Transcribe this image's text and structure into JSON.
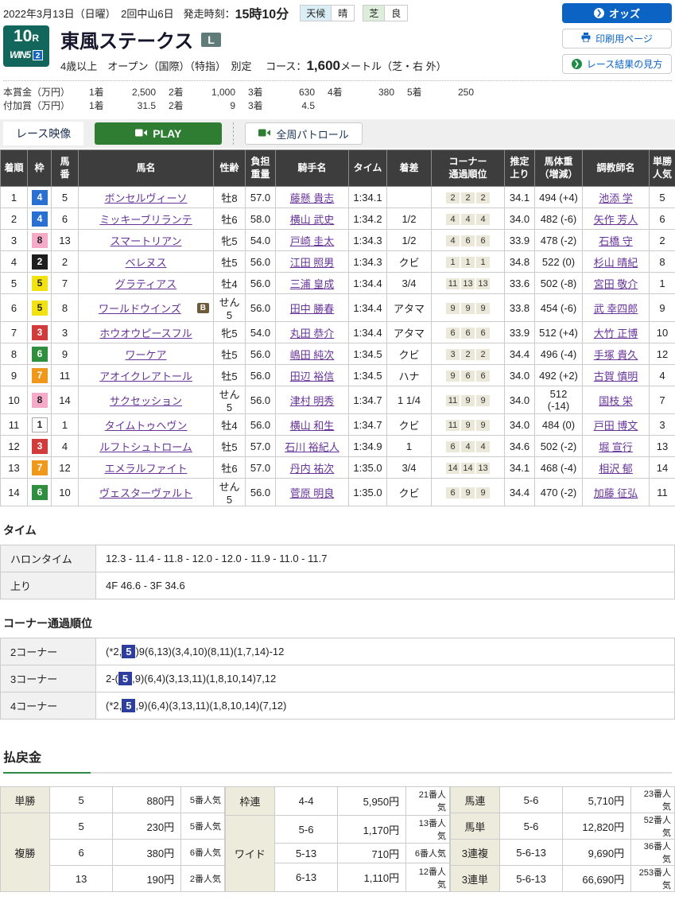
{
  "header": {
    "date_meet": "2022年3月13日（日曜）　2回中山6日",
    "start_label": "発走時刻：",
    "start_time": "15時10分",
    "weather_label": "天候",
    "weather_value": "晴",
    "turf_label": "芝",
    "turf_value": "良",
    "odds_button": "オッズ",
    "print_button": "印刷用ページ",
    "guide_button": "レース結果の見方"
  },
  "icons": {
    "odds_arrow": "❯",
    "guide_arrow": "❯",
    "printer": "printer-glyph",
    "camera": "camera-glyph"
  },
  "race": {
    "number": "10",
    "number_suffix": "R",
    "win5": "WIN5",
    "win5_num": "2",
    "name": "東風ステークス",
    "grade": "L",
    "conditions": "4歳以上　オープン（国際）（特指）　別定",
    "course_label": "コース：",
    "course_value": "1,600",
    "course_unit": "メートル（芝・右 外）"
  },
  "prize": {
    "main_label": "本賞金（万円）",
    "main": [
      {
        "r": "1着",
        "a": "2,500"
      },
      {
        "r": "2着",
        "a": "1,000"
      },
      {
        "r": "3着",
        "a": "630"
      },
      {
        "r": "4着",
        "a": "380"
      },
      {
        "r": "5着",
        "a": "250"
      }
    ],
    "added_label": "付加賞（万円）",
    "added": [
      {
        "r": "1着",
        "a": "31.5"
      },
      {
        "r": "2着",
        "a": "9"
      },
      {
        "r": "3着",
        "a": "4.5"
      }
    ]
  },
  "video": {
    "tab": "レース映像",
    "play": "PLAY",
    "patrol": "全周パトロール"
  },
  "results": {
    "headers": {
      "pos": "着順",
      "waku": "枠",
      "num": "馬\n番",
      "name": "馬名",
      "sexage": "性齢",
      "weight": "負担\n重量",
      "jockey": "騎手名",
      "time": "タイム",
      "margin": "着差",
      "corners": "コーナー\n通過順位",
      "last3f": "推定\n上り",
      "hweight": "馬体重\n（増減）",
      "trainer": "調教師名",
      "pop": "単勝\n人気"
    },
    "rows": [
      {
        "pos": "1",
        "waku": "4",
        "num": "5",
        "name": "ボンセルヴィーソ",
        "badge": "",
        "sexage": "牡8",
        "weight": "57.0",
        "jockey": "藤懸 貴志",
        "time": "1:34.1",
        "margin": "",
        "corners": [
          "2",
          "2",
          "2"
        ],
        "last3f": "34.1",
        "hweight": "494 (+4)",
        "trainer": "池添 学",
        "pop": "5"
      },
      {
        "pos": "2",
        "waku": "4",
        "num": "6",
        "name": "ミッキーブリランテ",
        "badge": "",
        "sexage": "牡6",
        "weight": "58.0",
        "jockey": "横山 武史",
        "time": "1:34.2",
        "margin": "1/2",
        "corners": [
          "4",
          "4",
          "4"
        ],
        "last3f": "34.0",
        "hweight": "482 (-6)",
        "trainer": "矢作 芳人",
        "pop": "6"
      },
      {
        "pos": "3",
        "waku": "8",
        "num": "13",
        "name": "スマートリアン",
        "badge": "",
        "sexage": "牝5",
        "weight": "54.0",
        "jockey": "戸崎 圭太",
        "time": "1:34.3",
        "margin": "1/2",
        "corners": [
          "4",
          "6",
          "6"
        ],
        "last3f": "33.9",
        "hweight": "478 (-2)",
        "trainer": "石橋 守",
        "pop": "2"
      },
      {
        "pos": "4",
        "waku": "2",
        "num": "2",
        "name": "ベレヌス",
        "badge": "",
        "sexage": "牡5",
        "weight": "56.0",
        "jockey": "江田 照男",
        "time": "1:34.3",
        "margin": "クビ",
        "corners": [
          "1",
          "1",
          "1"
        ],
        "last3f": "34.8",
        "hweight": "522 (0)",
        "trainer": "杉山 晴紀",
        "pop": "8"
      },
      {
        "pos": "5",
        "waku": "5",
        "num": "7",
        "name": "グラティアス",
        "badge": "",
        "sexage": "牡4",
        "weight": "56.0",
        "jockey": "三浦 皇成",
        "time": "1:34.4",
        "margin": "3/4",
        "corners": [
          "11",
          "13",
          "13"
        ],
        "last3f": "33.6",
        "hweight": "502 (-8)",
        "trainer": "宮田 敬介",
        "pop": "1"
      },
      {
        "pos": "6",
        "waku": "5",
        "num": "8",
        "name": "ワールドウインズ",
        "badge": "B",
        "sexage": "せん5",
        "weight": "56.0",
        "jockey": "田中 勝春",
        "time": "1:34.4",
        "margin": "アタマ",
        "corners": [
          "9",
          "9",
          "9"
        ],
        "last3f": "33.8",
        "hweight": "454 (-6)",
        "trainer": "武 幸四郎",
        "pop": "9"
      },
      {
        "pos": "7",
        "waku": "3",
        "num": "3",
        "name": "ホウオウピースフル",
        "badge": "",
        "sexage": "牝5",
        "weight": "54.0",
        "jockey": "丸田 恭介",
        "time": "1:34.4",
        "margin": "アタマ",
        "corners": [
          "6",
          "6",
          "6"
        ],
        "last3f": "33.9",
        "hweight": "512 (+4)",
        "trainer": "大竹 正博",
        "pop": "10"
      },
      {
        "pos": "8",
        "waku": "6",
        "num": "9",
        "name": "ワーケア",
        "badge": "",
        "sexage": "牡5",
        "weight": "56.0",
        "jockey": "嶋田 純次",
        "time": "1:34.5",
        "margin": "クビ",
        "corners": [
          "3",
          "2",
          "2"
        ],
        "last3f": "34.4",
        "hweight": "496 (-4)",
        "trainer": "手塚 貴久",
        "pop": "12"
      },
      {
        "pos": "9",
        "waku": "7",
        "num": "11",
        "name": "アオイクレアトール",
        "badge": "",
        "sexage": "牡5",
        "weight": "56.0",
        "jockey": "田辺 裕信",
        "time": "1:34.5",
        "margin": "ハナ",
        "corners": [
          "9",
          "6",
          "6"
        ],
        "last3f": "34.0",
        "hweight": "492 (+2)",
        "trainer": "古賀 慎明",
        "pop": "4"
      },
      {
        "pos": "10",
        "waku": "8",
        "num": "14",
        "name": "サクセッション",
        "badge": "",
        "sexage": "せん5",
        "weight": "56.0",
        "jockey": "津村 明秀",
        "time": "1:34.7",
        "margin": "1 1/4",
        "corners": [
          "11",
          "9",
          "9"
        ],
        "last3f": "34.0",
        "hweight": "512 (-14)",
        "trainer": "国枝 栄",
        "pop": "7"
      },
      {
        "pos": "11",
        "waku": "1",
        "num": "1",
        "name": "タイムトゥヘヴン",
        "badge": "",
        "sexage": "牡4",
        "weight": "56.0",
        "jockey": "横山 和生",
        "time": "1:34.7",
        "margin": "クビ",
        "corners": [
          "11",
          "9",
          "9"
        ],
        "last3f": "34.0",
        "hweight": "484 (0)",
        "trainer": "戸田 博文",
        "pop": "3"
      },
      {
        "pos": "12",
        "waku": "3",
        "num": "4",
        "name": "ルフトシュトローム",
        "badge": "",
        "sexage": "牡5",
        "weight": "57.0",
        "jockey": "石川 裕紀人",
        "time": "1:34.9",
        "margin": "1",
        "corners": [
          "6",
          "4",
          "4"
        ],
        "last3f": "34.6",
        "hweight": "502 (-2)",
        "trainer": "堀 宣行",
        "pop": "13"
      },
      {
        "pos": "13",
        "waku": "7",
        "num": "12",
        "name": "エメラルファイト",
        "badge": "",
        "sexage": "牡6",
        "weight": "57.0",
        "jockey": "丹内 祐次",
        "time": "1:35.0",
        "margin": "3/4",
        "corners": [
          "14",
          "14",
          "13"
        ],
        "last3f": "34.1",
        "hweight": "468 (-4)",
        "trainer": "相沢 郁",
        "pop": "14"
      },
      {
        "pos": "14",
        "waku": "6",
        "num": "10",
        "name": "ヴェスターヴァルト",
        "badge": "",
        "sexage": "せん5",
        "weight": "56.0",
        "jockey": "菅原 明良",
        "time": "1:35.0",
        "margin": "クビ",
        "corners": [
          "6",
          "9",
          "9"
        ],
        "last3f": "34.4",
        "hweight": "470 (-2)",
        "trainer": "加藤 征弘",
        "pop": "11"
      }
    ]
  },
  "time_section": {
    "title": "タイム",
    "rows": [
      {
        "label": "ハロンタイム",
        "value": "12.3 - 11.4 - 11.8 - 12.0 - 12.0 - 11.9 - 11.0 - 11.7"
      },
      {
        "label": "上り",
        "value": "4F 46.6 - 3F 34.6"
      }
    ]
  },
  "corner_section": {
    "title": "コーナー通過順位",
    "rows": [
      {
        "label": "2コーナー",
        "pre": "(*2,",
        "hl": "5",
        "post": ")9(6,13)(3,4,10)(8,11)(1,7,14)-12"
      },
      {
        "label": "3コーナー",
        "pre": "2-(",
        "hl": "5",
        "post": ",9)(6,4)(3,13,11)(1,8,10,14)7,12"
      },
      {
        "label": "4コーナー",
        "pre": "(*2,",
        "hl": "5",
        "post": ",9)(6,4)(3,13,11)(1,8,10,14)(7,12)"
      }
    ]
  },
  "payout": {
    "title": "払戻金",
    "tansho": {
      "label": "単勝",
      "combo": "5",
      "amount": "880円",
      "pop": "5番人気"
    },
    "fukusho": {
      "label": "複勝",
      "rows": [
        {
          "combo": "5",
          "amount": "230円",
          "pop": "5番人気"
        },
        {
          "combo": "6",
          "amount": "380円",
          "pop": "6番人気"
        },
        {
          "combo": "13",
          "amount": "190円",
          "pop": "2番人気"
        }
      ]
    },
    "wakuren": {
      "label": "枠連",
      "combo": "4-4",
      "amount": "5,950円",
      "pop": "21番人気"
    },
    "wide": {
      "label": "ワイド",
      "rows": [
        {
          "combo": "5-6",
          "amount": "1,170円",
          "pop": "13番人気"
        },
        {
          "combo": "5-13",
          "amount": "710円",
          "pop": "6番人気"
        },
        {
          "combo": "6-13",
          "amount": "1,110円",
          "pop": "12番人気"
        }
      ]
    },
    "umaren": {
      "label": "馬連",
      "combo": "5-6",
      "amount": "5,710円",
      "pop": "23番人気"
    },
    "umatan": {
      "label": "馬単",
      "combo": "5-6",
      "amount": "12,820円",
      "pop": "52番人気"
    },
    "sanrenpuku": {
      "label": "3連複",
      "combo": "5-6-13",
      "amount": "9,690円",
      "pop": "36番人気"
    },
    "sanrentan": {
      "label": "3連単",
      "combo": "5-6-13",
      "amount": "66,690円",
      "pop": "253番人気"
    }
  }
}
